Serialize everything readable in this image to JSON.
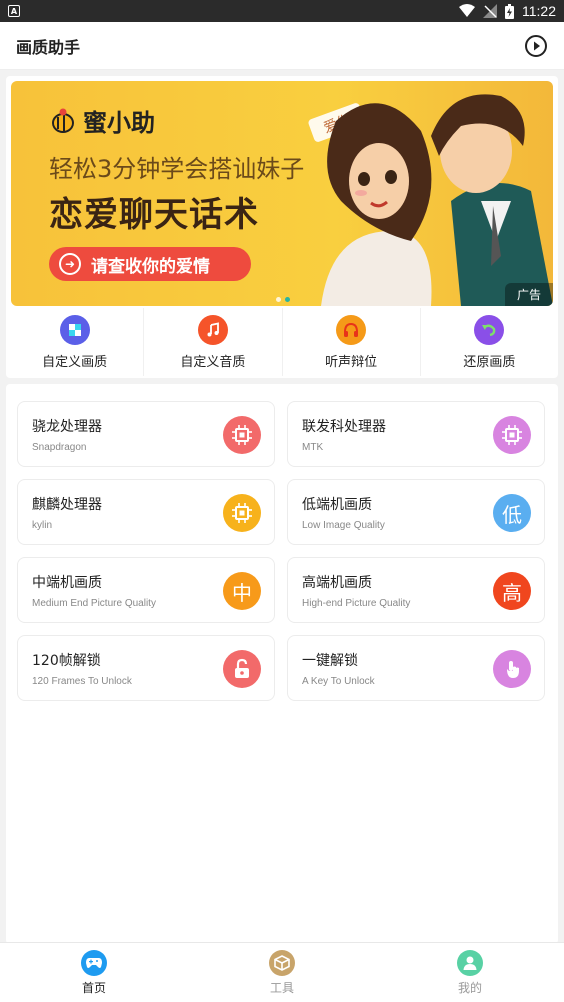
{
  "status": {
    "time": "11:22",
    "left_icon": "A"
  },
  "appbar": {
    "title": "画质助手",
    "play_icon": "play-circle-icon"
  },
  "banner": {
    "brand": "蜜小助",
    "line1": "轻松3分钟学会搭讪妹子",
    "line2": "恋爱聊天话术",
    "cta": "请查收你的爱情",
    "ad": "广告",
    "sticker": "爱你"
  },
  "quick": [
    {
      "label": "自定义画质",
      "icon": "picture-icon",
      "color": "#5b5fe8"
    },
    {
      "label": "自定义音质",
      "icon": "music-note-icon",
      "color": "#f5542a"
    },
    {
      "label": "听声辩位",
      "icon": "headphones-icon",
      "color": "#f59a18"
    },
    {
      "label": "还原画质",
      "icon": "undo-icon",
      "color": "#8a4fe8"
    }
  ],
  "tiles": [
    {
      "title": "骁龙处理器",
      "subtitle": "Snapdragon",
      "icon": "chip-icon",
      "color": "#f26a6a",
      "glyph": ""
    },
    {
      "title": "联发科处理器",
      "subtitle": "MTK",
      "icon": "chip-icon",
      "color": "#d884e0",
      "glyph": ""
    },
    {
      "title": "麒麟处理器",
      "subtitle": "kylin",
      "icon": "chip-icon",
      "color": "#f7b21c",
      "glyph": ""
    },
    {
      "title": "低端机画质",
      "subtitle": "Low Image Quality",
      "icon": "low-text-icon",
      "color": "#5aaef0",
      "glyph": "低"
    },
    {
      "title": "中端机画质",
      "subtitle": "Medium End Picture Quality",
      "icon": "mid-text-icon",
      "color": "#f79a1a",
      "glyph": "中"
    },
    {
      "title": "高端机画质",
      "subtitle": "High-end Picture Quality",
      "icon": "high-text-icon",
      "color": "#f0461e",
      "glyph": "高"
    },
    {
      "title": "120帧解锁",
      "subtitle": "120 Frames To Unlock",
      "icon": "unlock-icon",
      "color": "#f26a6a",
      "glyph": ""
    },
    {
      "title": "一键解锁",
      "subtitle": "A Key To Unlock",
      "icon": "hand-tap-icon",
      "color": "#d884e0",
      "glyph": ""
    }
  ],
  "tabs": [
    {
      "label": "首页",
      "icon": "gamepad-icon",
      "color": "#1e9bf0",
      "active": true
    },
    {
      "label": "工具",
      "icon": "box-icon",
      "color": "#c8a46a",
      "active": false
    },
    {
      "label": "我的",
      "icon": "user-icon",
      "color": "#58d1a4",
      "active": false
    }
  ]
}
